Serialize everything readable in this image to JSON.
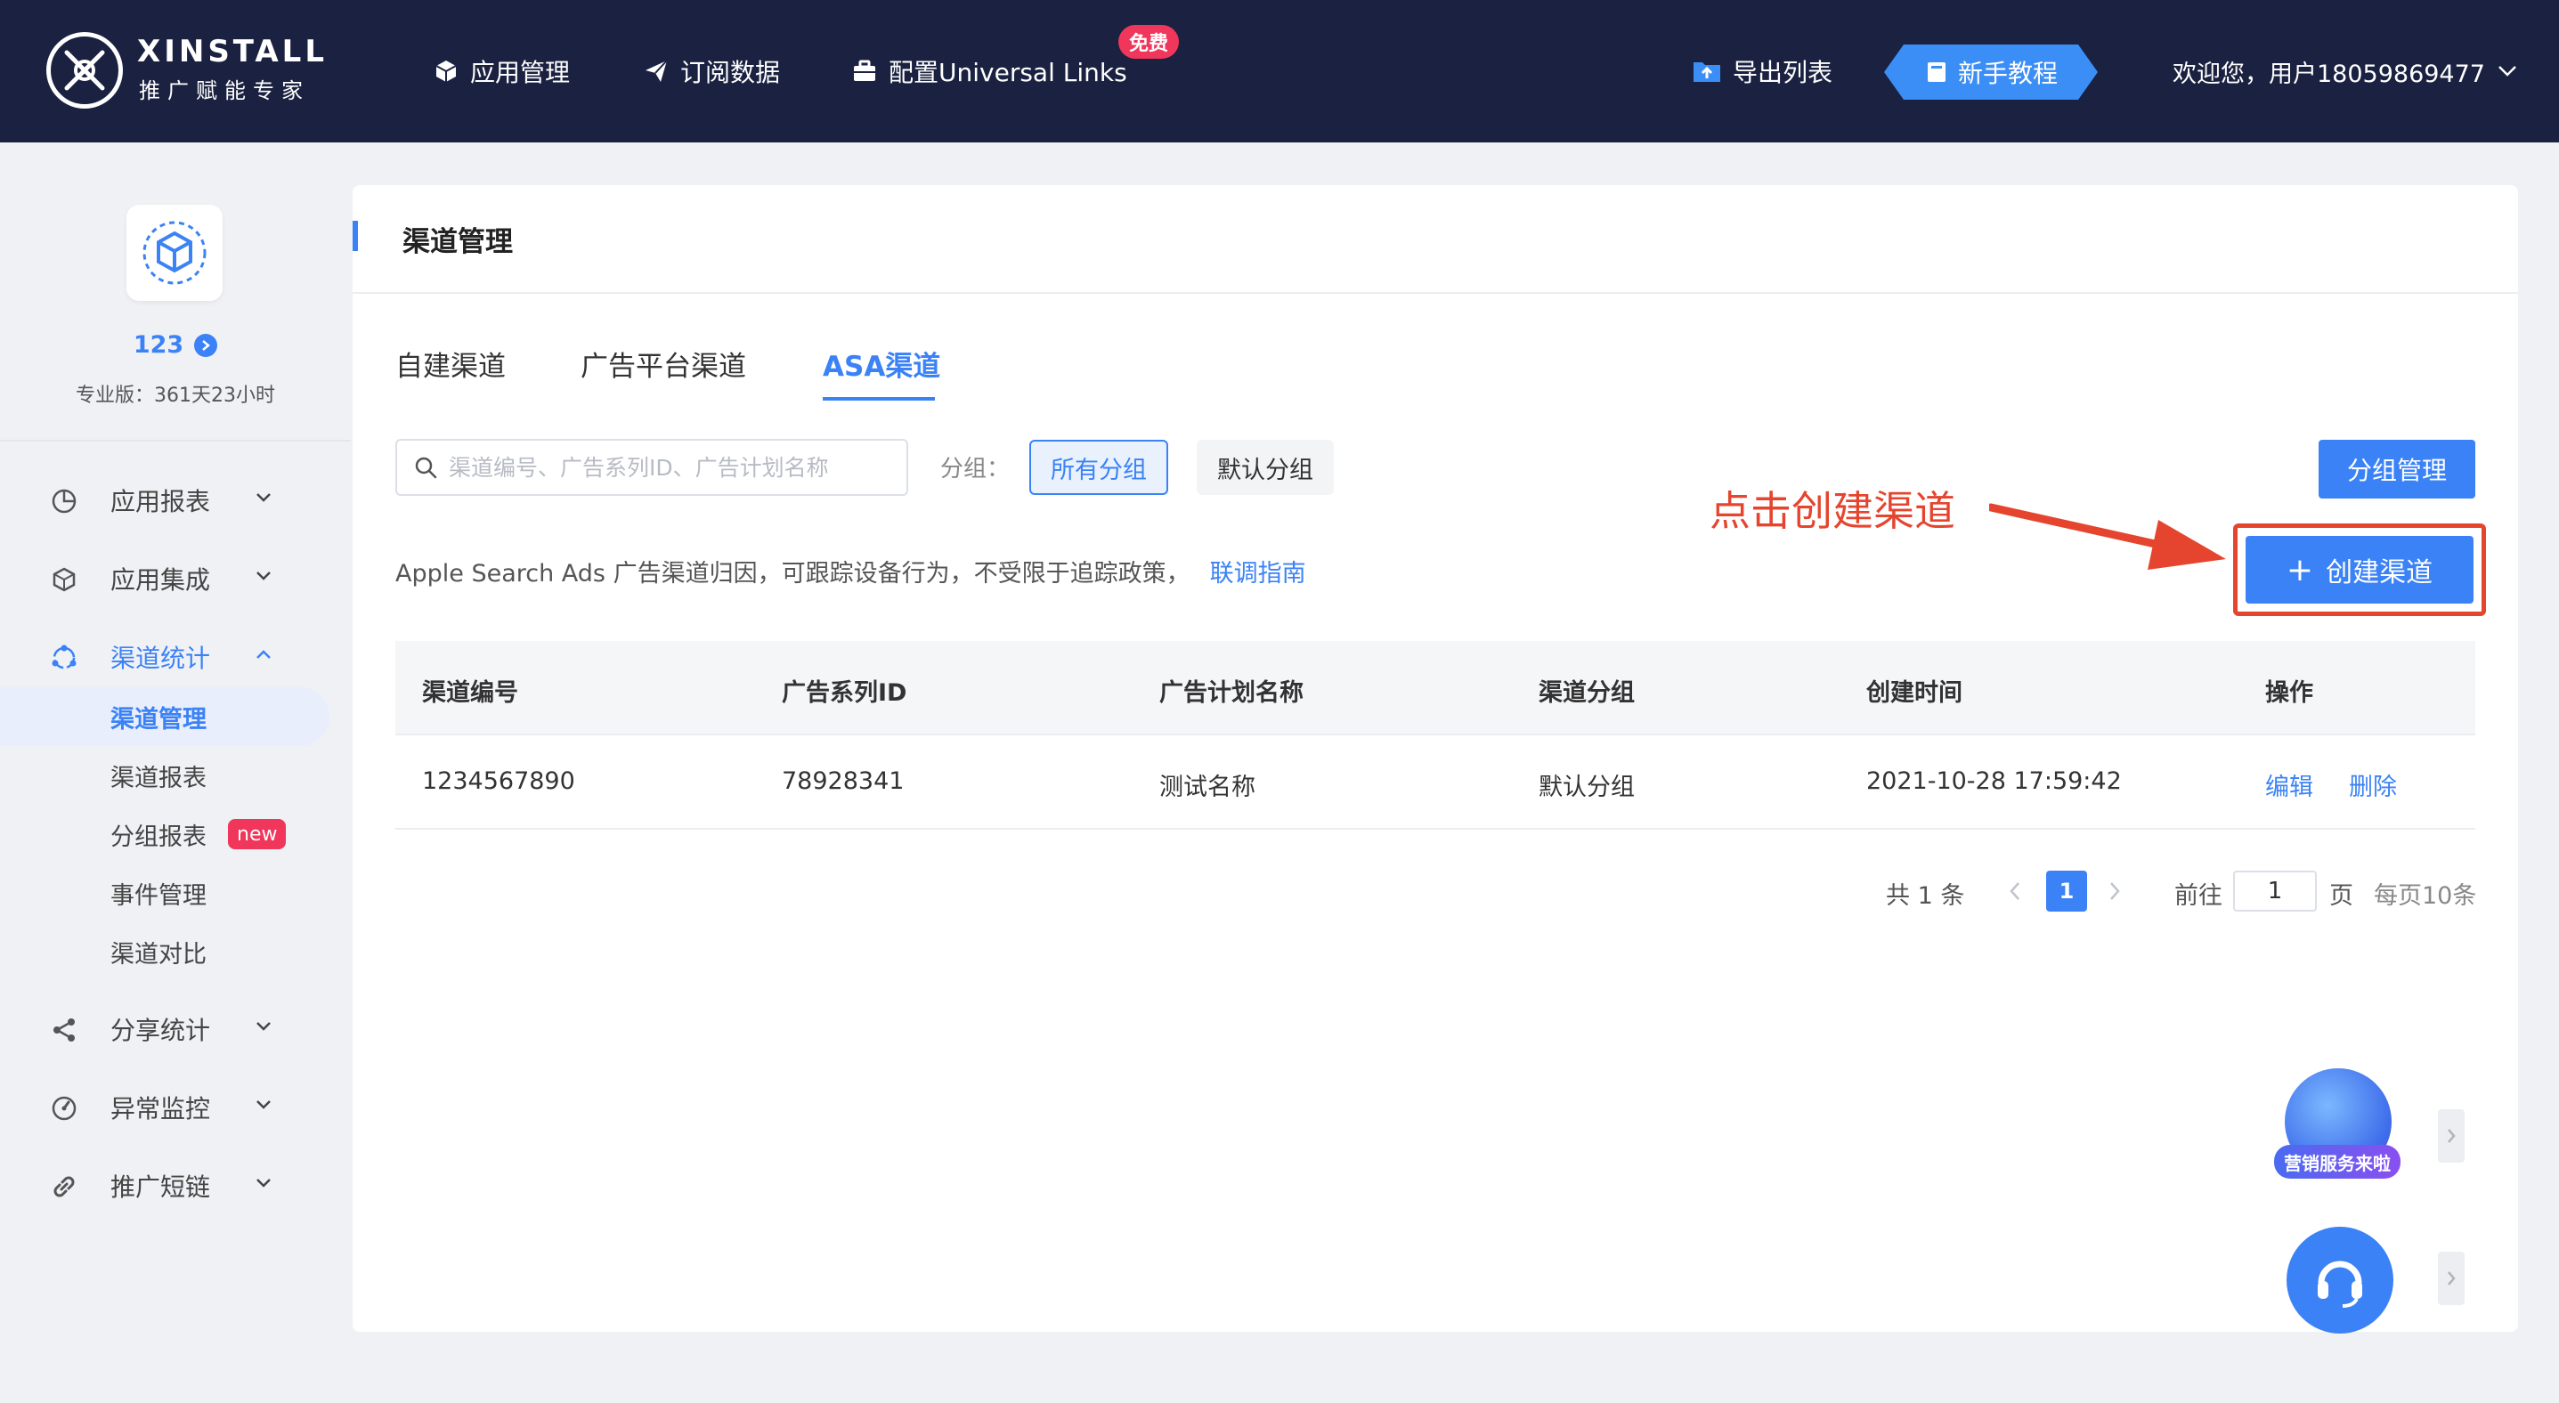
{
  "brand": {
    "name": "XINSTALL",
    "tagline": "推广赋能专家"
  },
  "topnav": {
    "apps": "应用管理",
    "subscriptions": "订阅数据",
    "universal_links": "配置Universal Links",
    "free_badge": "免费",
    "export": "导出列表",
    "tutorial": "新手教程",
    "welcome": "欢迎您，用户18059869477"
  },
  "app": {
    "name": "123",
    "plan": "专业版：361天23小时"
  },
  "sidebar": {
    "menus": [
      {
        "label": "应用报表",
        "icon": "pie-chart-icon"
      },
      {
        "label": "应用集成",
        "icon": "cube-icon"
      },
      {
        "label": "渠道统计",
        "icon": "channel-icon"
      },
      {
        "label": "分享统计",
        "icon": "share-icon"
      },
      {
        "label": "异常监控",
        "icon": "gauge-icon"
      },
      {
        "label": "推广短链",
        "icon": "link-icon"
      }
    ],
    "channel_sub": [
      {
        "label": "渠道管理"
      },
      {
        "label": "渠道报表"
      },
      {
        "label": "分组报表",
        "badge": "new"
      },
      {
        "label": "事件管理"
      },
      {
        "label": "渠道对比"
      }
    ]
  },
  "main": {
    "title": "渠道管理",
    "tabs": [
      "自建渠道",
      "广告平台渠道",
      "ASA渠道"
    ],
    "active_tab": "ASA渠道",
    "search_placeholder": "渠道编号、广告系列ID、广告计划名称",
    "group_label": "分组：",
    "groups": [
      "所有分组",
      "默认分组"
    ],
    "group_manage_button": "分组管理",
    "create_button": "创建渠道",
    "annotation": "点击创建渠道",
    "info_text": "Apple Search Ads 广告渠道归因，可跟踪设备行为，不受限于追踪政策，",
    "info_link": "联调指南",
    "table": {
      "headers": [
        "渠道编号",
        "广告系列ID",
        "广告计划名称",
        "渠道分组",
        "创建时间",
        "操作"
      ],
      "rows": [
        {
          "channel_id": "1234567890",
          "campaign_id": "78928341",
          "plan_name": "测试名称",
          "group": "默认分组",
          "created": "2021-10-28 17:59:42",
          "edit": "编辑",
          "delete": "删除"
        }
      ]
    },
    "pagination": {
      "total": "共 1 条",
      "current_page": "1",
      "goto_label": "前往",
      "goto_value": "1",
      "page_unit": "页",
      "page_size": "每页10条"
    }
  },
  "widgets": {
    "promo_label": "营销服务来啦"
  },
  "colors": {
    "topbar": "#1b2140",
    "accent": "#3b82f6",
    "annotation": "#e5452f",
    "badge": "#f0365a"
  }
}
